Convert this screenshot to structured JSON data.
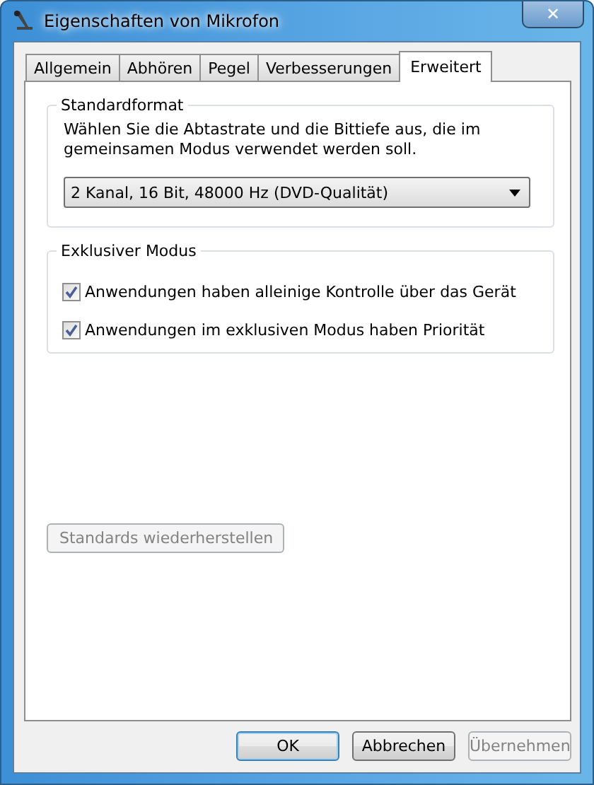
{
  "window": {
    "title": "Eigenschaften von Mikrofon",
    "close": "✕"
  },
  "tabs": [
    {
      "label": "Allgemein",
      "selected": false
    },
    {
      "label": "Abhören",
      "selected": false
    },
    {
      "label": "Pegel",
      "selected": false
    },
    {
      "label": "Verbesserungen",
      "selected": false
    },
    {
      "label": "Erweitert",
      "selected": true
    }
  ],
  "standardformat": {
    "title": "Standardformat",
    "description": "Wählen Sie die Abtastrate und die Bittiefe aus, die im gemeinsamen Modus verwendet werden soll.",
    "format": "2 Kanal, 16 Bit, 48000 Hz (DVD-Qualität)"
  },
  "exclusive_mode": {
    "title": "Exklusiver Modus",
    "options": [
      {
        "label": "Anwendungen haben alleinige Kontrolle über das Gerät",
        "checked": true
      },
      {
        "label": "Anwendungen im exklusiven Modus haben Priorität",
        "checked": true
      }
    ]
  },
  "restore_button": {
    "label": "Standards wiederherstellen",
    "disabled": true
  },
  "buttons": [
    {
      "label": "OK",
      "default": true,
      "disabled": false
    },
    {
      "label": "Abbrechen",
      "default": false,
      "disabled": false
    },
    {
      "label": "Übernehmen",
      "default": false,
      "disabled": true
    }
  ]
}
